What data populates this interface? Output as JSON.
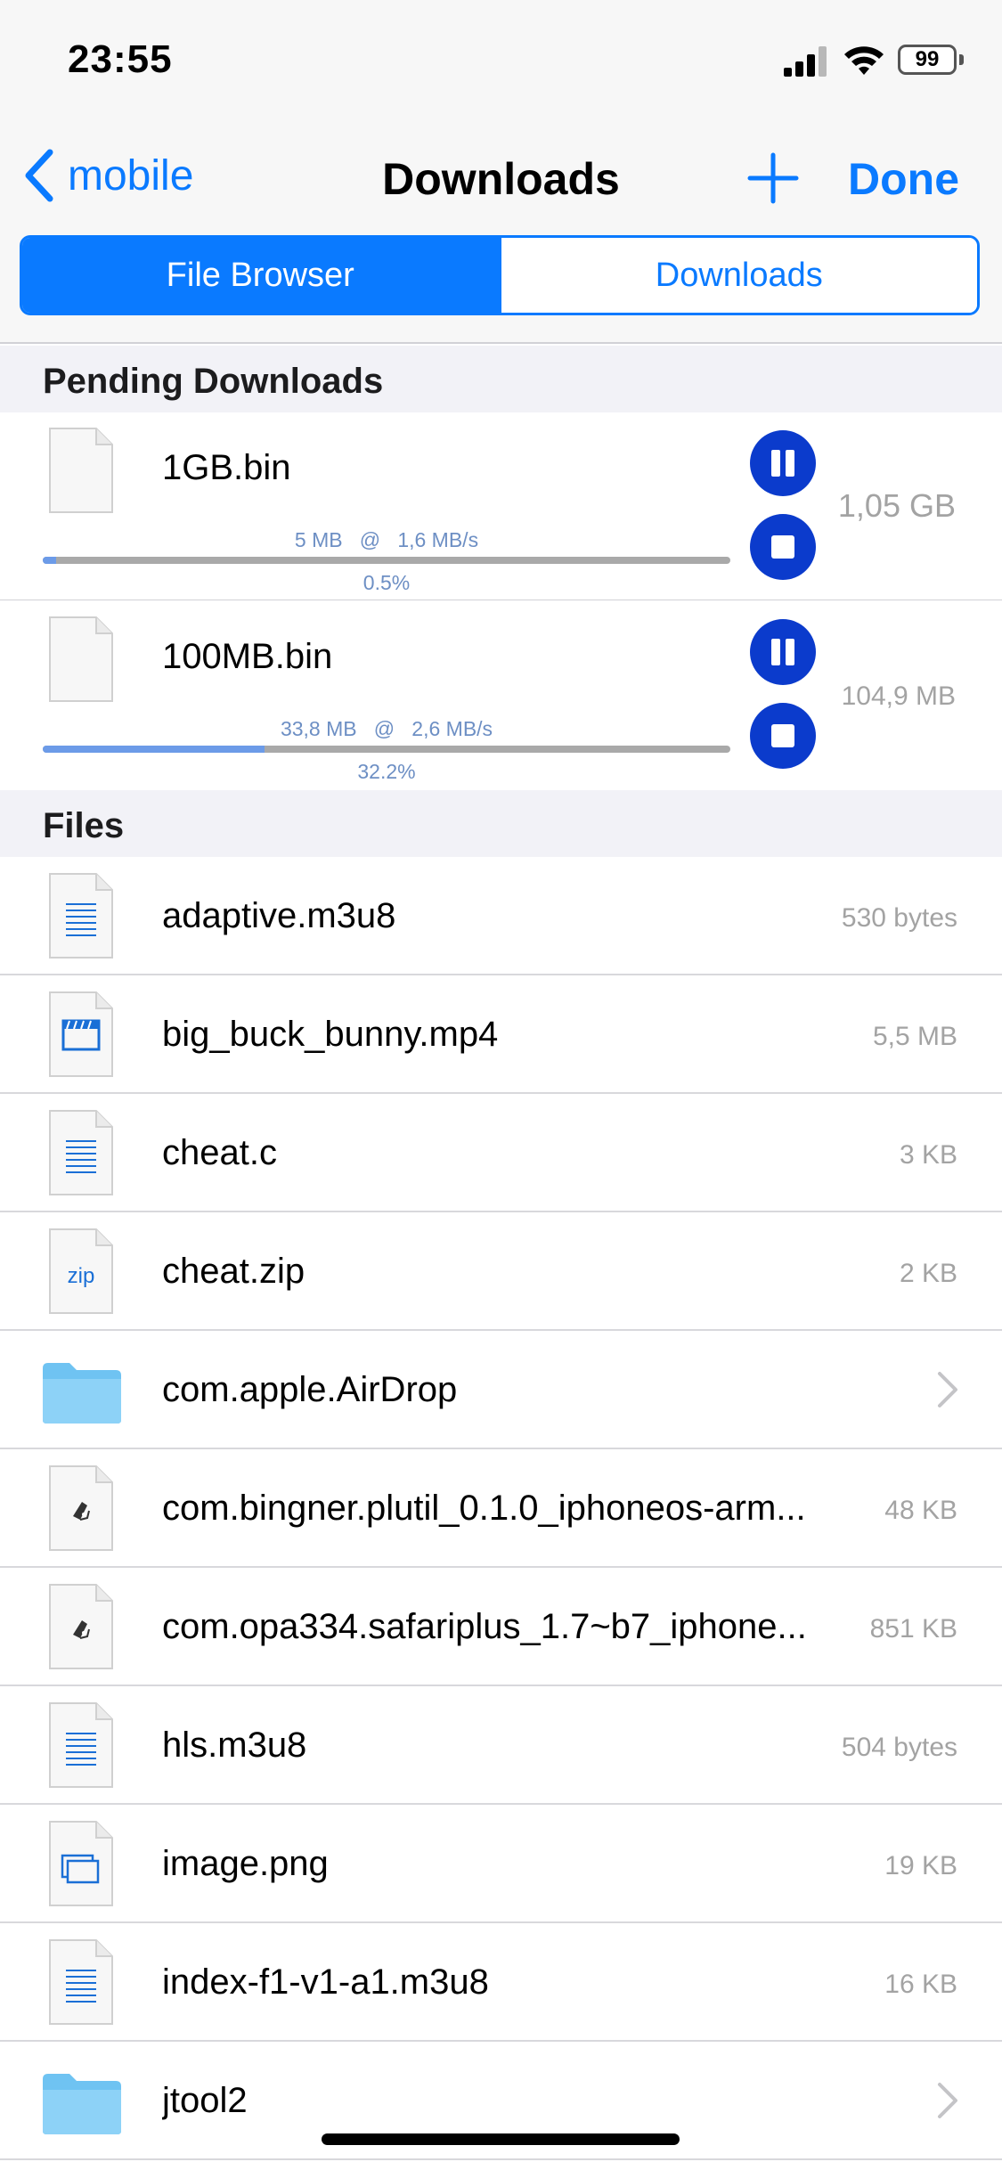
{
  "status_bar": {
    "time": "23:55",
    "battery": "99"
  },
  "nav": {
    "back_label": "mobile",
    "title": "Downloads",
    "add_icon": "plus-icon",
    "done_label": "Done"
  },
  "segments": {
    "file_browser": "File Browser",
    "downloads": "Downloads",
    "selected": "File Browser"
  },
  "pending": {
    "header": "Pending Downloads",
    "items": [
      {
        "name": "1GB.bin",
        "downloaded": "5 MB",
        "speed": "1,6 MB/s",
        "at": "@",
        "percent_label": "0.5%",
        "progress": 0.005,
        "size": "1,05 GB"
      },
      {
        "name": "100MB.bin",
        "downloaded": "33,8 MB",
        "speed": "2,6 MB/s",
        "at": "@",
        "percent_label": "32.2%",
        "progress": 0.322,
        "size": "104,9 MB"
      }
    ]
  },
  "files": {
    "header": "Files",
    "items": [
      {
        "name": "adaptive.m3u8",
        "size": "530 bytes",
        "icon": "text-document-icon",
        "kind": "text"
      },
      {
        "name": "big_buck_bunny.mp4",
        "size": "5,5 MB",
        "icon": "video-document-icon",
        "kind": "video"
      },
      {
        "name": "cheat.c",
        "size": "3 KB",
        "icon": "text-document-icon",
        "kind": "text"
      },
      {
        "name": "cheat.zip",
        "size": "2 KB",
        "icon": "zip-document-icon",
        "kind": "zip",
        "icon_label": "zip"
      },
      {
        "name": "com.apple.AirDrop",
        "size": "",
        "icon": "folder-icon",
        "kind": "folder"
      },
      {
        "name": "com.bingner.plutil_0.1.0_iphoneos-arm...",
        "size": "48 KB",
        "icon": "package-document-icon",
        "kind": "package"
      },
      {
        "name": "com.opa334.safariplus_1.7~b7_iphone...",
        "size": "851 KB",
        "icon": "package-document-icon",
        "kind": "package"
      },
      {
        "name": "hls.m3u8",
        "size": "504 bytes",
        "icon": "text-document-icon",
        "kind": "text"
      },
      {
        "name": "image.png",
        "size": "19 KB",
        "icon": "image-document-icon",
        "kind": "image"
      },
      {
        "name": "index-f1-v1-a1.m3u8",
        "size": "16 KB",
        "icon": "text-document-icon",
        "kind": "text"
      },
      {
        "name": "jtool2",
        "size": "",
        "icon": "folder-icon",
        "kind": "folder"
      }
    ]
  },
  "colors": {
    "accent": "#0a7aff",
    "control_button": "#0b3bcc",
    "progress_fill": "#6c9be8",
    "progress_track": "#a9a9a9",
    "folder": "#7ecbf5"
  }
}
